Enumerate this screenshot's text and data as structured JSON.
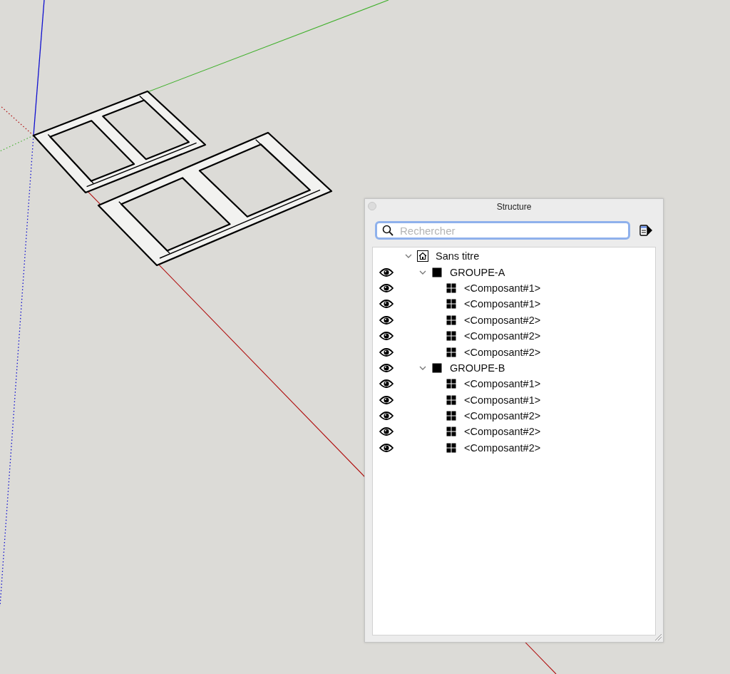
{
  "panel": {
    "title": "Structure",
    "search": {
      "placeholder": "Rechercher"
    },
    "tree": [
      {
        "label": "Sans titre",
        "kind": "model",
        "expanded": true,
        "children": [
          {
            "label": "GROUPE-A",
            "kind": "group",
            "visible": true,
            "expanded": true,
            "children": [
              {
                "label": "<Composant#1>",
                "kind": "component",
                "visible": true
              },
              {
                "label": "<Composant#1>",
                "kind": "component",
                "visible": true
              },
              {
                "label": "<Composant#2>",
                "kind": "component",
                "visible": true
              },
              {
                "label": "<Composant#2>",
                "kind": "component",
                "visible": true
              },
              {
                "label": "<Composant#2>",
                "kind": "component",
                "visible": true
              }
            ]
          },
          {
            "label": "GROUPE-B",
            "kind": "group",
            "visible": true,
            "expanded": true,
            "children": [
              {
                "label": "<Composant#1>",
                "kind": "component",
                "visible": true
              },
              {
                "label": "<Composant#1>",
                "kind": "component",
                "visible": true
              },
              {
                "label": "<Composant#2>",
                "kind": "component",
                "visible": true
              },
              {
                "label": "<Composant#2>",
                "kind": "component",
                "visible": true
              },
              {
                "label": "<Composant#2>",
                "kind": "component",
                "visible": true
              }
            ]
          }
        ]
      }
    ]
  }
}
